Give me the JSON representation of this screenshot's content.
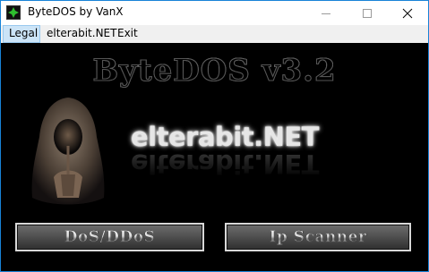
{
  "window": {
    "title": "ByteDOS by VanX"
  },
  "menu": {
    "items": [
      {
        "label": "Legal"
      },
      {
        "label": "elterabit.NET"
      },
      {
        "label": "Exit"
      }
    ]
  },
  "main": {
    "heading": "ByteDOS v3.2",
    "site_label": "elterabit.NET",
    "buttons": {
      "dos": "DoS/DDoS",
      "ip_scanner": "Ip Scanner"
    }
  }
}
